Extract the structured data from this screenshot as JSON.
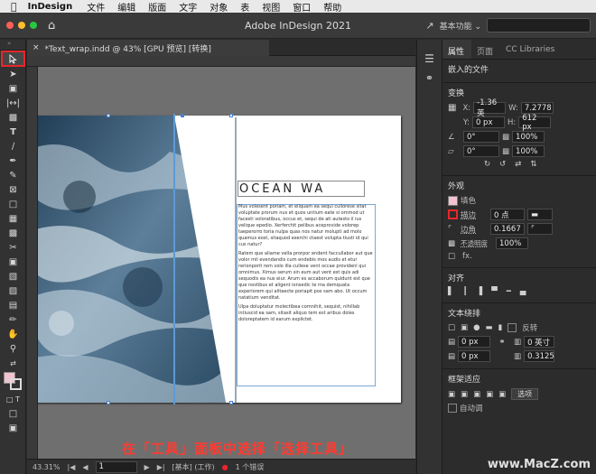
{
  "menubar": {
    "apple": "",
    "app": "InDesign",
    "items": [
      "文件",
      "编辑",
      "版面",
      "文字",
      "对象",
      "表",
      "视图",
      "窗口",
      "帮助"
    ]
  },
  "titlebar": {
    "title": "Adobe InDesign 2021",
    "workspace": "基本功能 ⌄"
  },
  "document": {
    "tab_label": "*Text_wrap.indd @ 43% [GPU 预览] [转换]",
    "heading": "OCEAN WA",
    "paragraphs": [
      "Mus volesent poriam, et eliquam ea sequi cullorese sitat voluptate prorum nus et quos untium eate si ommod ut facesti voloratibus, occus et, sequi de ati autesto il ius velique epedio. Xerferchit pelibus aceprovide volorep taeperorro toria nulpa quas nos natur molupti ad molo quamus eost, sitaquod exerchi ctaest volupta tiusti id qui cus natur?",
      "Ratem que aliame vella prorpor endent faccullabor aut que volor mil evendandis cum endebis mos audis et etur rerionporit rem volo illa cullese vent occae providenl qui omnimus. Ximus serum sin eum aut vent est quis adi sequodis ea nus eiur. Arum es accaborum quidunt est que que nostibus et aligent ionsedic te ma demquata experiorem qui alitaecte poriapit pos sam abo. Ut occum natatium venditat.",
      "Ulpa doluptatur molectibea comnihit, sequist, nihillab intiuscid ea sam, sitasit aliquo tem est aribus doles doloreptatem id earum explictet."
    ]
  },
  "status": {
    "zoom": "43.31%",
    "page": "1",
    "master": "[基本] (工作)",
    "errors": "1 个错误"
  },
  "panel": {
    "tabs": [
      "属性",
      "页面",
      "CC Libraries"
    ],
    "object_type": "嵌入的文件",
    "transform": {
      "title": "变换",
      "x_label": "X:",
      "x": "-1.36 英",
      "w_label": "W:",
      "w": "7.2778",
      "y_label": "Y:",
      "y": "0 px",
      "h_label": "H:",
      "h": "612 px",
      "rotate": "0°",
      "scale_x": "100%",
      "shear": "0°",
      "scale_y": "100%"
    },
    "appearance": {
      "title": "外观",
      "fill": "填色",
      "stroke": "描边",
      "stroke_weight": "0 点",
      "corner": "边角",
      "corner_value": "0.1667",
      "opacity_label": "不透明度",
      "opacity": "100%",
      "fx": "fx."
    },
    "align_title": "对齐",
    "text_wrap": {
      "title": "文本绕排",
      "invert": "反转",
      "top": "0 px",
      "left": "0 px",
      "right": "0 英寸",
      "bottom": "0.3125"
    },
    "frame_fitting": {
      "title": "框架适应",
      "options": "选项",
      "auto": "自动调"
    }
  },
  "caption": "在「工具」面板中选择「选择工具」",
  "watermark": "www.MacZ.com",
  "colors": {
    "highlight": "#e8262b",
    "caption": "#ff3b30",
    "selection": "#5b9bd5",
    "fill_swatch": "#f2c4cf"
  }
}
